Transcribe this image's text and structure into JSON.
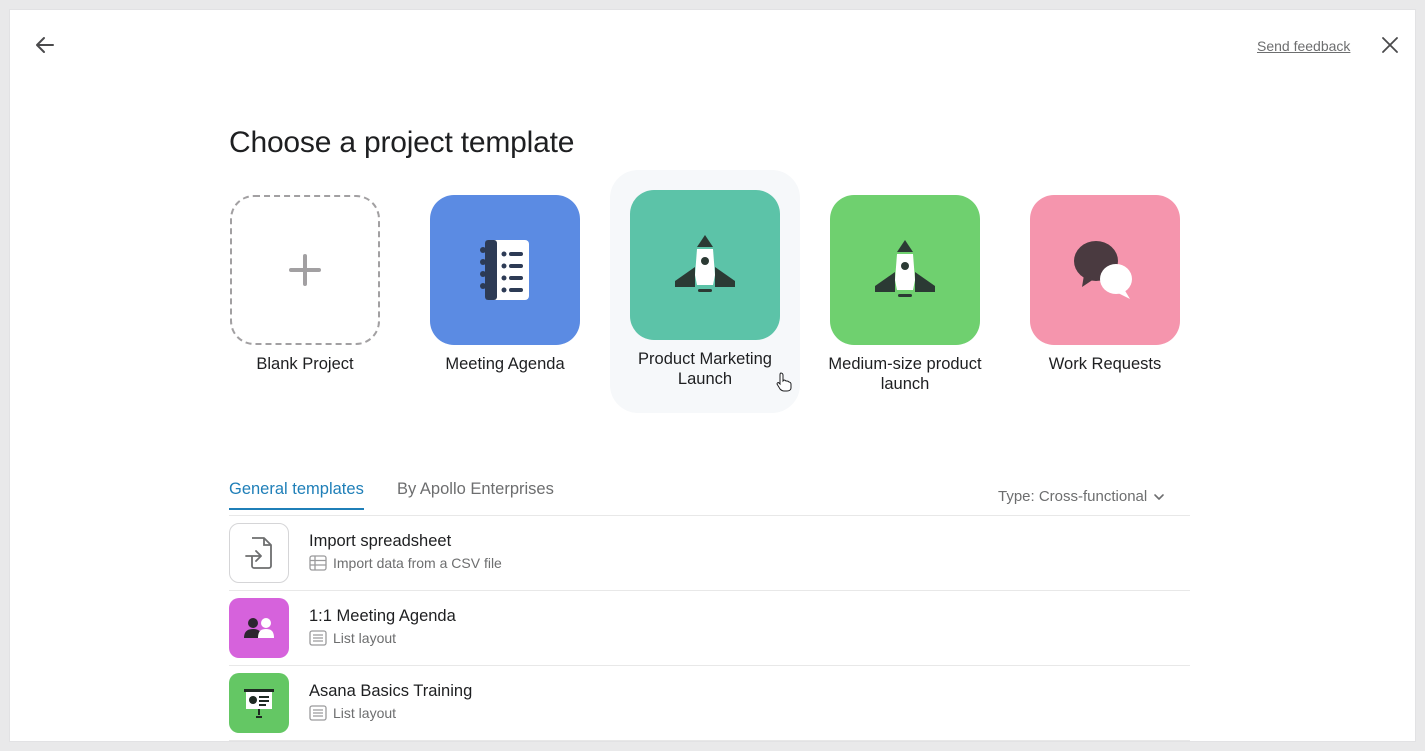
{
  "header": {
    "feedback_label": "Send feedback",
    "back_icon": "arrow-left-icon",
    "close_icon": "close-icon"
  },
  "page": {
    "title": "Choose a project template"
  },
  "featured_templates": [
    {
      "label": "Blank Project",
      "icon": "plus-icon",
      "color": "#ffffff"
    },
    {
      "label": "Meeting Agenda",
      "icon": "notebook-list-icon",
      "color": "#5b8be3"
    },
    {
      "label": "Product Marketing Launch",
      "icon": "rocket-icon",
      "color": "#5cc3a8"
    },
    {
      "label": "Medium-size product launch",
      "icon": "rocket-icon",
      "color": "#6fd06f"
    },
    {
      "label": "Work Requests",
      "icon": "chat-bubbles-icon",
      "color": "#f595ad"
    }
  ],
  "tabs": [
    {
      "label": "General templates",
      "active": true
    },
    {
      "label": "By Apollo Enterprises",
      "active": false
    }
  ],
  "filter": {
    "label": "Type: Cross-functional",
    "icon": "chevron-down-icon"
  },
  "template_list": [
    {
      "title": "Import spreadsheet",
      "subtitle": "Import data from a CSV file",
      "icon": "file-import-icon",
      "sub_icon": "spreadsheet-icon",
      "color": "#ffffff"
    },
    {
      "title": "1:1 Meeting Agenda",
      "subtitle": "List layout",
      "icon": "people-icon",
      "sub_icon": "list-layout-icon",
      "color": "#d662dc"
    },
    {
      "title": "Asana Basics Training",
      "subtitle": "List layout",
      "icon": "presentation-icon",
      "sub_icon": "list-layout-icon",
      "color": "#64c764"
    }
  ]
}
